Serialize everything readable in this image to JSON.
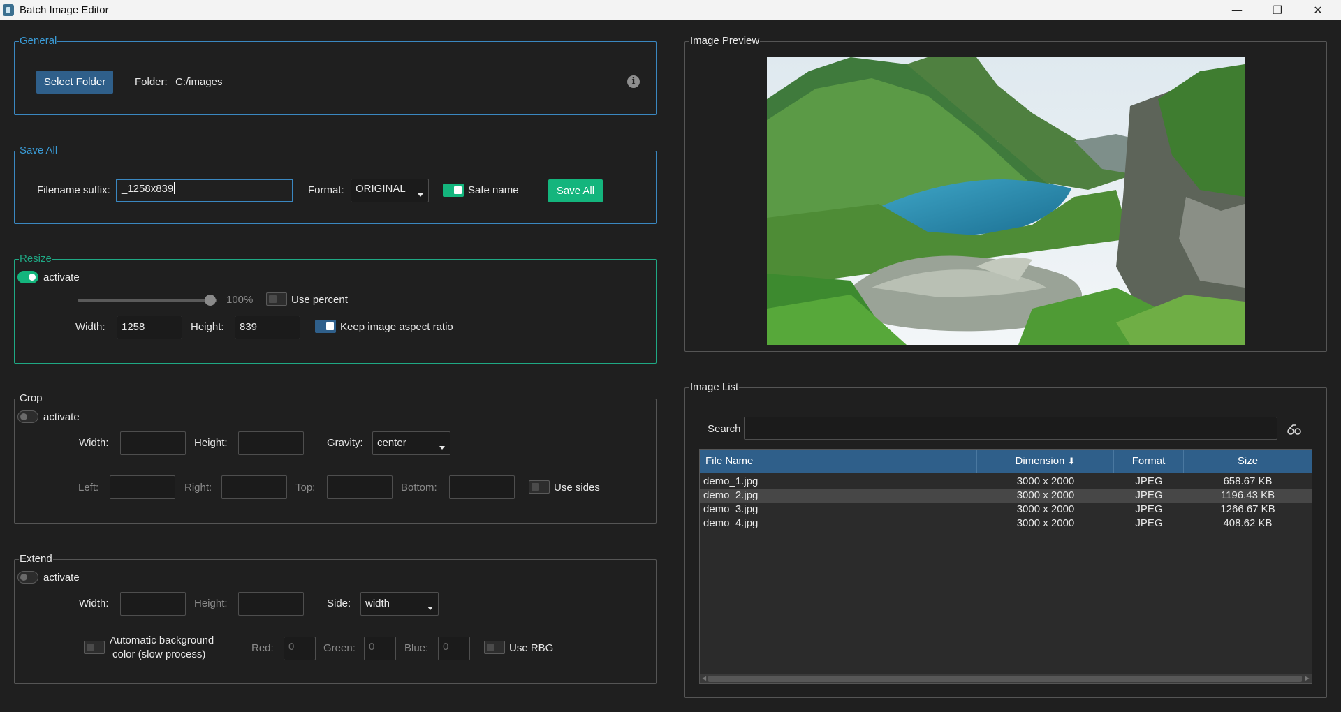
{
  "window": {
    "title": "Batch Image Editor",
    "minimize": "—",
    "restore": "❐",
    "close": "✕"
  },
  "general": {
    "legend": "General",
    "select_folder": "Select Folder",
    "folder_label": "Folder:",
    "folder_value": "C:/images",
    "info_icon": "i"
  },
  "save_all": {
    "legend": "Save All",
    "suffix_label": "Filename suffix:",
    "suffix_value": "_1258x839",
    "format_label": "Format:",
    "format_value": "ORIGINAL",
    "safe_name_label": "Safe name",
    "safe_name_checked": true,
    "save_button": "Save All"
  },
  "resize": {
    "legend": "Resize",
    "activate_label": "activate",
    "activate_on": true,
    "percent_value": "100%",
    "use_percent_label": "Use percent",
    "width_label": "Width:",
    "width_value": "1258",
    "height_label": "Height:",
    "height_value": "839",
    "keep_aspect_label": "Keep image aspect ratio",
    "keep_aspect_checked": true
  },
  "crop": {
    "legend": "Crop",
    "activate_label": "activate",
    "width_label": "Width:",
    "height_label": "Height:",
    "gravity_label": "Gravity:",
    "gravity_value": "center",
    "left_label": "Left:",
    "right_label": "Right:",
    "top_label": "Top:",
    "bottom_label": "Bottom:",
    "use_sides_label": "Use sides"
  },
  "extend": {
    "legend": "Extend",
    "activate_label": "activate",
    "width_label": "Width:",
    "height_label": "Height:",
    "side_label": "Side:",
    "side_value": "width",
    "auto_bg_line1": "Automatic background",
    "auto_bg_line2": "color (slow process)",
    "red_label": "Red:",
    "red_value": "0",
    "green_label": "Green:",
    "green_value": "0",
    "blue_label": "Blue:",
    "blue_value": "0",
    "use_rbg_label": "Use RBG"
  },
  "preview": {
    "legend": "Image Preview"
  },
  "image_list": {
    "legend": "Image List",
    "search_label": "Search",
    "search_value": "",
    "columns": [
      "File Name",
      "Dimension",
      "Format",
      "Size"
    ],
    "sort_indicator": "⬇",
    "rows": [
      {
        "name": "demo_1.jpg",
        "dimension": "3000 x 2000",
        "format": "JPEG",
        "size": "658.67 KB"
      },
      {
        "name": "demo_2.jpg",
        "dimension": "3000 x 2000",
        "format": "JPEG",
        "size": "1196.43 KB"
      },
      {
        "name": "demo_3.jpg",
        "dimension": "3000 x 2000",
        "format": "JPEG",
        "size": "1266.67 KB"
      },
      {
        "name": "demo_4.jpg",
        "dimension": "3000 x 2000",
        "format": "JPEG",
        "size": "408.62 KB"
      }
    ],
    "selected_row": 1
  },
  "colors": {
    "background": "#1f1f1f",
    "accent_blue": "#2f5f8a",
    "accent_green": "#14b57d",
    "group_blue_border": "#3a87c0",
    "group_green_border": "#1fa884"
  }
}
